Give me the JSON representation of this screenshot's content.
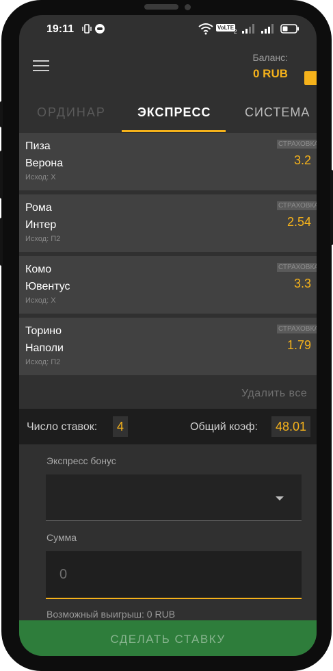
{
  "status_bar": {
    "time": "19:11",
    "icons": [
      "vibrate-icon",
      "app-notification-icon",
      "wifi-icon",
      "volte-icon",
      "signal-icon",
      "signal-icon",
      "battery-icon"
    ],
    "volte_label": "VoLTE",
    "sim_index": "2"
  },
  "header": {
    "balance_label": "Баланс:",
    "balance_value": "0 RUB"
  },
  "tabs": [
    {
      "label": "ОРДИНАР",
      "active": false
    },
    {
      "label": "ЭКСПРЕСС",
      "active": true
    },
    {
      "label": "СИСТЕМА",
      "active": false
    }
  ],
  "bets": [
    {
      "team1": "Пиза",
      "team2": "Верона",
      "outcome": "Исход: X",
      "insurance": "СТРАХОВКА",
      "coef": "3.2"
    },
    {
      "team1": "Рома",
      "team2": "Интер",
      "outcome": "Исход: П2",
      "insurance": "СТРАХОВКА",
      "coef": "2.54"
    },
    {
      "team1": "Комо",
      "team2": "Ювентус",
      "outcome": "Исход: X",
      "insurance": "СТРАХОВКА",
      "coef": "3.3"
    },
    {
      "team1": "Торино",
      "team2": "Наполи",
      "outcome": "Исход: П2",
      "insurance": "СТРАХОВКА",
      "coef": "1.79"
    }
  ],
  "delete_all": "Удалить все",
  "summary": {
    "bets_count_label": "Число ставок:",
    "bets_count": "4",
    "total_coef_label": "Общий коэф:",
    "total_coef": "48.01"
  },
  "form": {
    "express_bonus_label": "Экспресс бонус",
    "express_bonus_value": "",
    "amount_label": "Сумма",
    "amount_placeholder": "0",
    "possible_win": "Возможный выигрыш: 0 RUB"
  },
  "make_bet_label": "СДЕЛАТЬ СТАВКУ",
  "colors": {
    "accent": "#f5b21b",
    "background": "#303030",
    "bet_card": "#414141",
    "button": "#2e7d3b"
  }
}
